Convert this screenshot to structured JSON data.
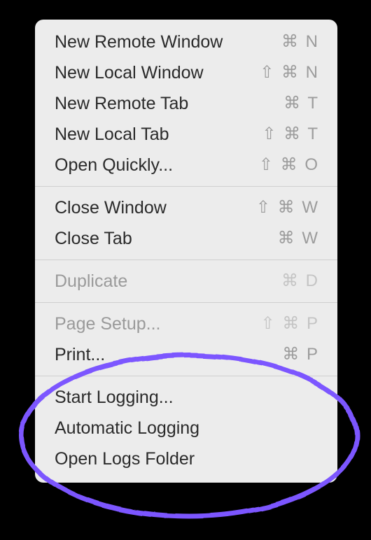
{
  "menu": {
    "groups": [
      [
        {
          "label": "New Remote Window",
          "shortcut": "⌘ N",
          "disabled": false
        },
        {
          "label": "New Local Window",
          "shortcut": "⇧ ⌘ N",
          "disabled": false
        },
        {
          "label": "New Remote Tab",
          "shortcut": "⌘ T",
          "disabled": false
        },
        {
          "label": "New Local Tab",
          "shortcut": "⇧ ⌘ T",
          "disabled": false
        },
        {
          "label": "Open Quickly...",
          "shortcut": "⇧ ⌘ O",
          "disabled": false
        }
      ],
      [
        {
          "label": "Close Window",
          "shortcut": "⇧ ⌘ W",
          "disabled": false
        },
        {
          "label": "Close Tab",
          "shortcut": "⌘ W",
          "disabled": false
        }
      ],
      [
        {
          "label": "Duplicate",
          "shortcut": "⌘ D",
          "disabled": true
        }
      ],
      [
        {
          "label": "Page Setup...",
          "shortcut": "⇧ ⌘ P",
          "disabled": true
        },
        {
          "label": "Print...",
          "shortcut": "⌘ P",
          "disabled": false
        }
      ],
      [
        {
          "label": "Start Logging...",
          "shortcut": "",
          "disabled": false
        },
        {
          "label": "Automatic Logging",
          "shortcut": "",
          "disabled": false
        },
        {
          "label": "Open Logs Folder",
          "shortcut": "",
          "disabled": false
        }
      ]
    ]
  },
  "annotation": {
    "color": "#7b57ff"
  }
}
